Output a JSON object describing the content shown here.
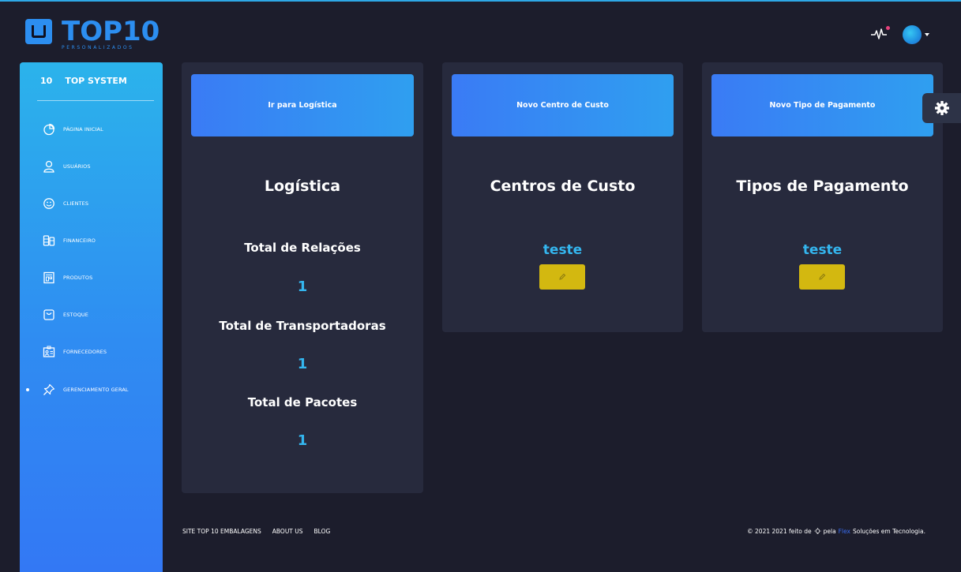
{
  "brand": {
    "logo_text": "TOP10",
    "logo_subtext": "PERSONALIZADOS",
    "sidebar_short": "10",
    "sidebar_title": "TOP SYSTEM"
  },
  "icons": {
    "activity": "activity-pulse-icon",
    "avatar": "user-avatar-icon",
    "settings": "gear-icon"
  },
  "sidebar": {
    "items": [
      {
        "label": "PÁGINA INICIAL",
        "icon": "pie-chart-icon",
        "active": false
      },
      {
        "label": "USUÁRIOS",
        "icon": "user-icon",
        "active": false
      },
      {
        "label": "CLIENTES",
        "icon": "smiley-icon",
        "active": false
      },
      {
        "label": "FINANCEIRO",
        "icon": "coins-icon",
        "active": false
      },
      {
        "label": "PRODUTOS",
        "icon": "box-icon",
        "active": false
      },
      {
        "label": "ESTOQUE",
        "icon": "bag-icon",
        "active": false
      },
      {
        "label": "FORNECEDORES",
        "icon": "id-card-icon",
        "active": false
      },
      {
        "label": "GERENCIAMENTO GERAL",
        "icon": "pin-icon",
        "active": true
      }
    ]
  },
  "cards": {
    "logistica": {
      "button": "Ir para Logística",
      "title": "Logística",
      "stats": [
        {
          "label": "Total de Relações",
          "value": "1"
        },
        {
          "label": "Total de Transportadoras",
          "value": "1"
        },
        {
          "label": "Total de Pacotes",
          "value": "1"
        }
      ]
    },
    "centros": {
      "button": "Novo Centro de Custo",
      "title": "Centros de Custo",
      "item": "teste"
    },
    "pagamentos": {
      "button": "Novo Tipo de Pagamento",
      "title": "Tipos de Pagamento",
      "item": "teste"
    }
  },
  "footer": {
    "links": [
      "SITE TOP 10 EMBALAGENS",
      "ABOUT US",
      "BLOG"
    ],
    "copyright_prefix": "© 2021 2021 feito de",
    "copyright_by": "pela",
    "company": "Flex",
    "copyright_suffix": "Soluções em Tecnologia."
  },
  "colors": {
    "background": "#1c1d2c",
    "card": "#272a3d",
    "accent": "#34b6ef",
    "edit_button": "#d3b810"
  }
}
